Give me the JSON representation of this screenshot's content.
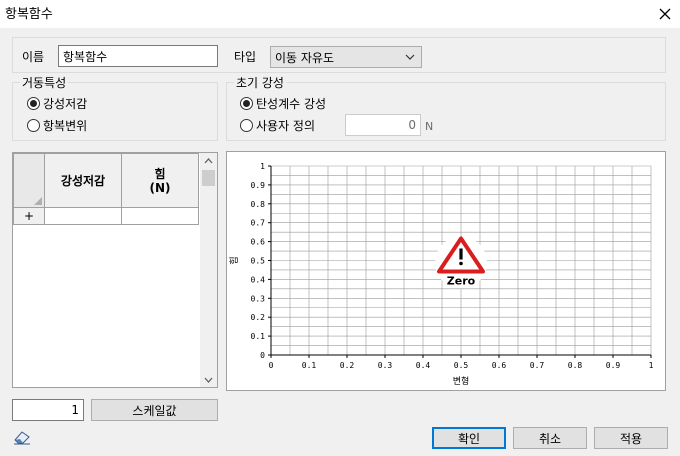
{
  "dialog": {
    "title": "항복함수"
  },
  "name_field": {
    "label": "이름",
    "value": "항복함수"
  },
  "type_field": {
    "label": "타입",
    "value": "이동 자유도"
  },
  "behavior": {
    "legend": "거동특성",
    "options": [
      "강성저감",
      "항복변위"
    ],
    "selected": 0
  },
  "initial_stiffness": {
    "legend": "초기 강성",
    "options": [
      "탄성계수 강성",
      "사용자 정의"
    ],
    "selected": 0,
    "user_value": "0",
    "unit": "N"
  },
  "table": {
    "headers": [
      "강성저감",
      "힘\n(N)"
    ],
    "new_row_marker": "+"
  },
  "scale": {
    "value": "1",
    "button_label": "스케일값"
  },
  "buttons": {
    "ok": "확인",
    "cancel": "취소",
    "apply": "적용"
  },
  "chart_data": {
    "type": "line",
    "xlabel": "변형",
    "ylabel": "힘",
    "xlim": [
      0,
      1
    ],
    "ylim": [
      0,
      1
    ],
    "x_ticks": [
      "0",
      "0.1",
      "0.2",
      "0.3",
      "0.4",
      "0.5",
      "0.6",
      "0.7",
      "0.8",
      "0.9",
      "1"
    ],
    "y_ticks": [
      "0",
      "0.1",
      "0.2",
      "0.3",
      "0.4",
      "0.5",
      "0.6",
      "0.7",
      "0.8",
      "0.9",
      "1"
    ],
    "grid": true,
    "series": [],
    "warning_label": "Zero",
    "warning_icon": "warning-triangle-icon"
  }
}
